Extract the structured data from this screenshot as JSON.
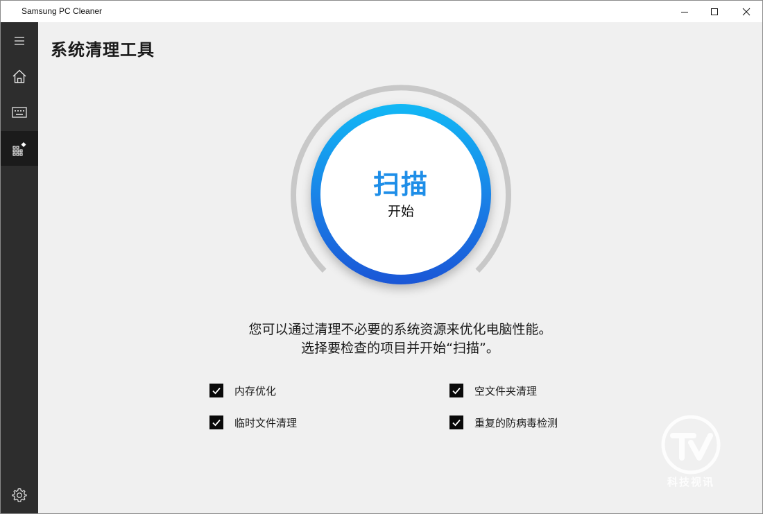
{
  "window": {
    "title": "Samsung PC Cleaner"
  },
  "sidebar": {
    "items": [
      {
        "icon": "menu-icon"
      },
      {
        "icon": "home-icon"
      },
      {
        "icon": "keyboard-icon"
      },
      {
        "icon": "cleaner-tool-icon",
        "active": true
      },
      {
        "icon": "settings-icon"
      }
    ]
  },
  "main": {
    "title": "系统清理工具",
    "scan": {
      "label": "扫描",
      "sublabel": "开始"
    },
    "description": {
      "line1": "您可以通过清理不必要的系统资源来优化电脑性能。",
      "line2": "选择要检查的项目并开始“扫描”。"
    },
    "options": [
      {
        "label": "内存优化",
        "checked": true
      },
      {
        "label": "空文件夹清理",
        "checked": true
      },
      {
        "label": "临时文件清理",
        "checked": true
      },
      {
        "label": "重复的防病毒检测",
        "checked": true
      }
    ]
  },
  "watermark": {
    "text": "科技视讯"
  },
  "colors": {
    "accent": "#1e8ee8",
    "gradient_top": "#12b8f5",
    "gradient_bottom": "#1a56d6",
    "sidebar": "#2d2d2d",
    "background": "#f0f0f0"
  }
}
